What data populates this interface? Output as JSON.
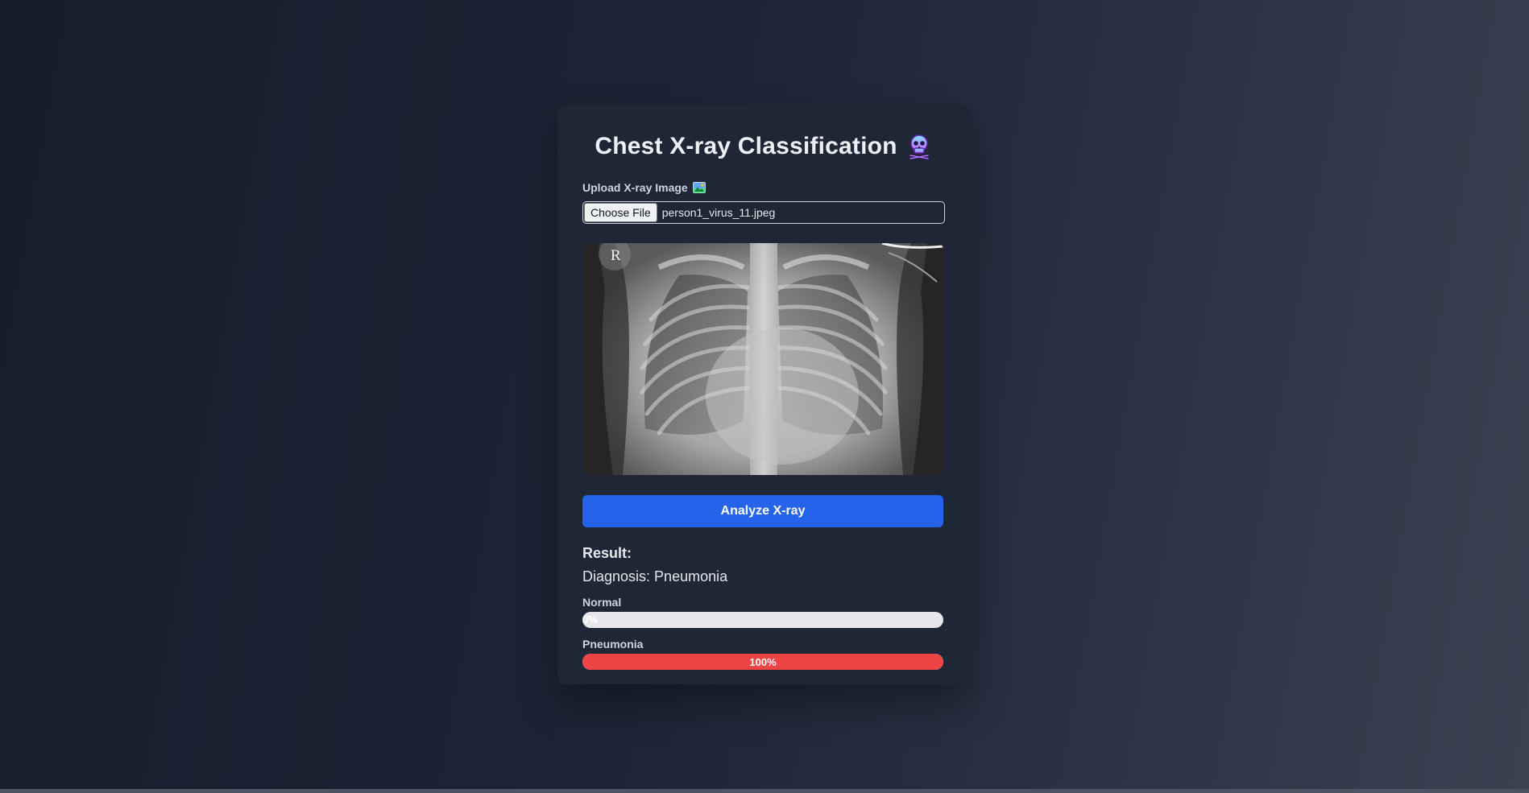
{
  "app": {
    "title": "Chest X-ray Classification",
    "title_icon": "skull-icon"
  },
  "upload": {
    "label": "Upload X-ray Image",
    "label_icon": "picture-icon",
    "button_label": "Choose File",
    "file_name": "person1_virus_11.jpeg"
  },
  "preview": {
    "marker_text": "R"
  },
  "actions": {
    "analyze_label": "Analyze X-ray"
  },
  "result": {
    "heading": "Result:",
    "diagnosis_label": "Diagnosis:",
    "diagnosis_value": "Pneumonia",
    "probabilities": [
      {
        "label": "Normal",
        "value_text": "0%",
        "fraction": 0.0,
        "color": "#3b82f6"
      },
      {
        "label": "Pneumonia",
        "value_text": "100%",
        "fraction": 1.0,
        "color": "#ef4444"
      }
    ]
  },
  "colors": {
    "primary": "#2563eb",
    "card": "#1f2736",
    "danger": "#ef4444",
    "track": "#e5e7eb"
  }
}
